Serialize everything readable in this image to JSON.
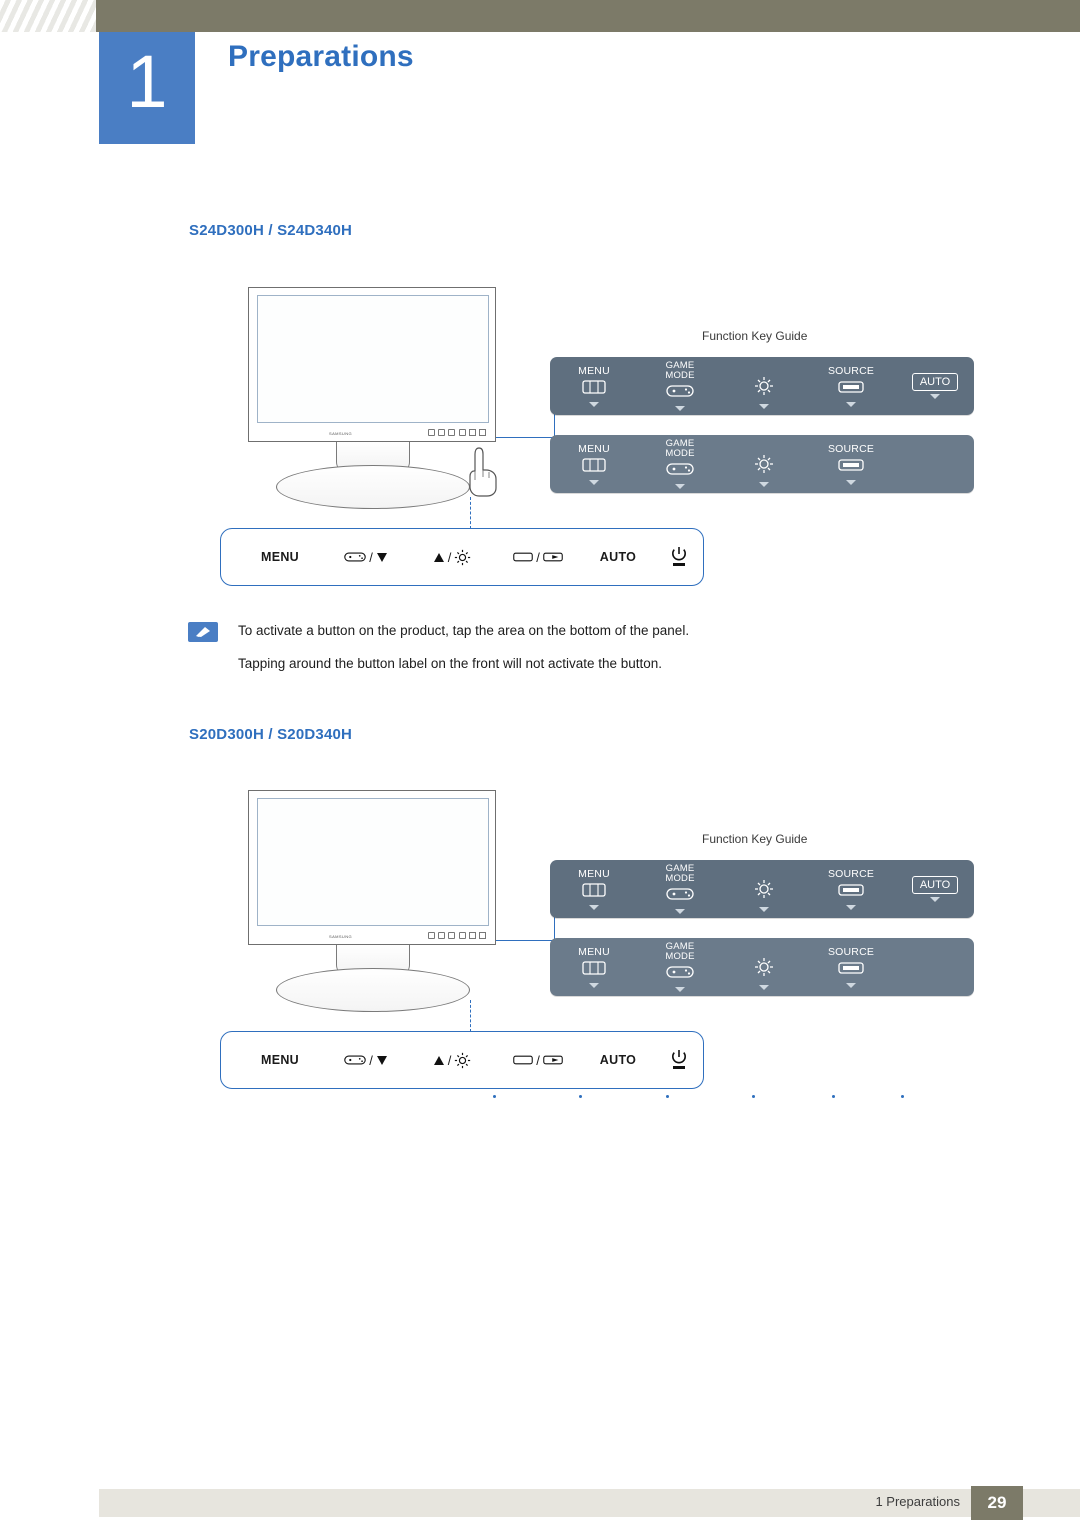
{
  "header": {
    "chapter_number": "1",
    "chapter_title": "Preparations"
  },
  "sections": [
    {
      "heading": "S24D300H / S24D340H",
      "function_key_guide_label": "Function Key Guide",
      "monitor_brand": "SAMSUNG",
      "guide_rows": [
        {
          "keys": [
            {
              "label": "MENU",
              "icon": "menu-icon"
            },
            {
              "label": "GAME MODE",
              "icon": "gamepad-icon"
            },
            {
              "label": "",
              "icon": "brightness-icon"
            },
            {
              "label": "SOURCE",
              "icon": "source-icon"
            },
            {
              "label": "AUTO",
              "icon": "auto-pill"
            }
          ]
        },
        {
          "keys": [
            {
              "label": "MENU",
              "icon": "menu-icon"
            },
            {
              "label": "GAME MODE",
              "icon": "gamepad-icon"
            },
            {
              "label": "",
              "icon": "brightness-icon"
            },
            {
              "label": "SOURCE",
              "icon": "source-icon"
            }
          ]
        }
      ],
      "key_strip": [
        {
          "label": "MENU",
          "glyph": ""
        },
        {
          "label": "",
          "glyph": "gamepad / down-arrow"
        },
        {
          "label": "",
          "glyph": "up-arrow / brightness"
        },
        {
          "label": "",
          "glyph": "source / enter"
        },
        {
          "label": "AUTO",
          "glyph": ""
        },
        {
          "label": "",
          "glyph": "power-icon"
        }
      ]
    },
    {
      "heading": "S20D300H / S20D340H",
      "function_key_guide_label": "Function Key Guide",
      "monitor_brand": "SAMSUNG",
      "guide_rows": [
        {
          "keys": [
            {
              "label": "MENU",
              "icon": "menu-icon"
            },
            {
              "label": "GAME MODE",
              "icon": "gamepad-icon"
            },
            {
              "label": "",
              "icon": "brightness-icon"
            },
            {
              "label": "SOURCE",
              "icon": "source-icon"
            },
            {
              "label": "AUTO",
              "icon": "auto-pill"
            }
          ]
        },
        {
          "keys": [
            {
              "label": "MENU",
              "icon": "menu-icon"
            },
            {
              "label": "GAME MODE",
              "icon": "gamepad-icon"
            },
            {
              "label": "",
              "icon": "brightness-icon"
            },
            {
              "label": "SOURCE",
              "icon": "source-icon"
            }
          ]
        }
      ],
      "key_strip": [
        {
          "label": "MENU",
          "glyph": ""
        },
        {
          "label": "",
          "glyph": "gamepad / down-arrow"
        },
        {
          "label": "",
          "glyph": "up-arrow / brightness"
        },
        {
          "label": "",
          "glyph": "source / enter"
        },
        {
          "label": "AUTO",
          "glyph": ""
        },
        {
          "label": "",
          "glyph": "power-icon"
        }
      ]
    }
  ],
  "labels": {
    "menu": "MENU",
    "game": "GAME",
    "mode": "MODE",
    "source": "SOURCE",
    "auto": "AUTO"
  },
  "note": {
    "line1": "To activate a button on the product, tap the area on the bottom of the panel.",
    "line2": "Tapping around the button label on the front will not activate the button."
  },
  "footer": {
    "text": "1 Preparations",
    "page": "29"
  },
  "colors": {
    "accent_blue": "#2f6fbe",
    "header_olive": "#7c7a68",
    "badge_blue": "#4a7ec4",
    "panel_slate": "#5f6f7f",
    "footer_grey": "#e7e5de"
  }
}
